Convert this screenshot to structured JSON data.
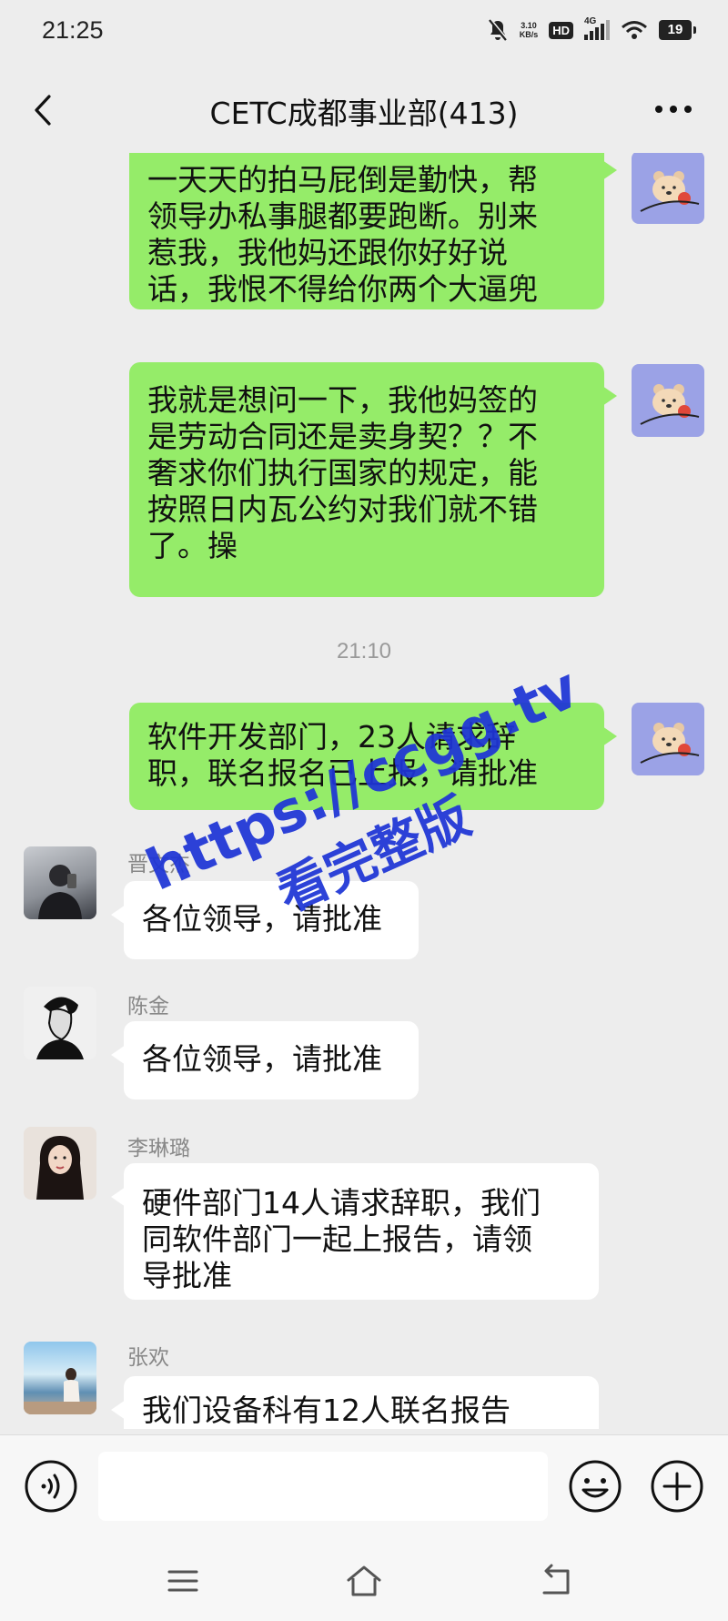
{
  "status_bar": {
    "time": "21:25",
    "net_speed_value": "3.10",
    "net_speed_unit": "KB/s",
    "hd_badge": "HD",
    "network": "4G",
    "battery": "19"
  },
  "header": {
    "title": "CETC成都事业部(413)"
  },
  "messages": [
    {
      "sender": "",
      "side": "right",
      "lines": [
        "一天天的拍马屁倒是勤快，帮",
        "领导办私事腿都要跑断。别来",
        "惹我，我他妈还跟你好好说",
        "话，我恨不得给你两个大逼兜"
      ]
    },
    {
      "sender": "",
      "side": "right",
      "lines": [
        "我就是想问一下，我他妈签的",
        "是劳动合同还是卖身契？？不",
        "奢求你们执行国家的规定，能",
        "按照日内瓦公约对我们就不错",
        "了。操"
      ]
    },
    {
      "sender": "",
      "side": "right",
      "lines": [
        "软件开发部门，23人请求辞",
        "职，联名报名已上报，请批准"
      ]
    },
    {
      "sender": "晋文杰",
      "side": "left",
      "lines": [
        "各位领导，请批准"
      ]
    },
    {
      "sender": "陈金",
      "side": "left",
      "lines": [
        "各位领导，请批准"
      ]
    },
    {
      "sender": "李琳璐",
      "side": "left",
      "lines": [
        "硬件部门14人请求辞职，我们",
        "同软件部门一起上报告，请领",
        "导批准"
      ]
    },
    {
      "sender": "张欢",
      "side": "left",
      "lines": [
        "我们设备科有12人联名报告"
      ]
    }
  ],
  "timestamp": "21:10",
  "watermark": {
    "line1": "https://ccgg.tv",
    "line2": "看完整版"
  },
  "input": {
    "placeholder": ""
  },
  "icons": {
    "back": "chevron-left-icon",
    "more": "more-dots-icon",
    "voice": "voice-icon",
    "emoji": "emoji-icon",
    "plus": "plus-icon",
    "nav_menu": "menu-icon",
    "nav_home": "home-icon",
    "nav_back": "back-icon"
  },
  "colors": {
    "my_bubble": "#95ec69",
    "their_bubble": "#ffffff",
    "background": "#ededed",
    "watermark": "#1e35d6"
  }
}
